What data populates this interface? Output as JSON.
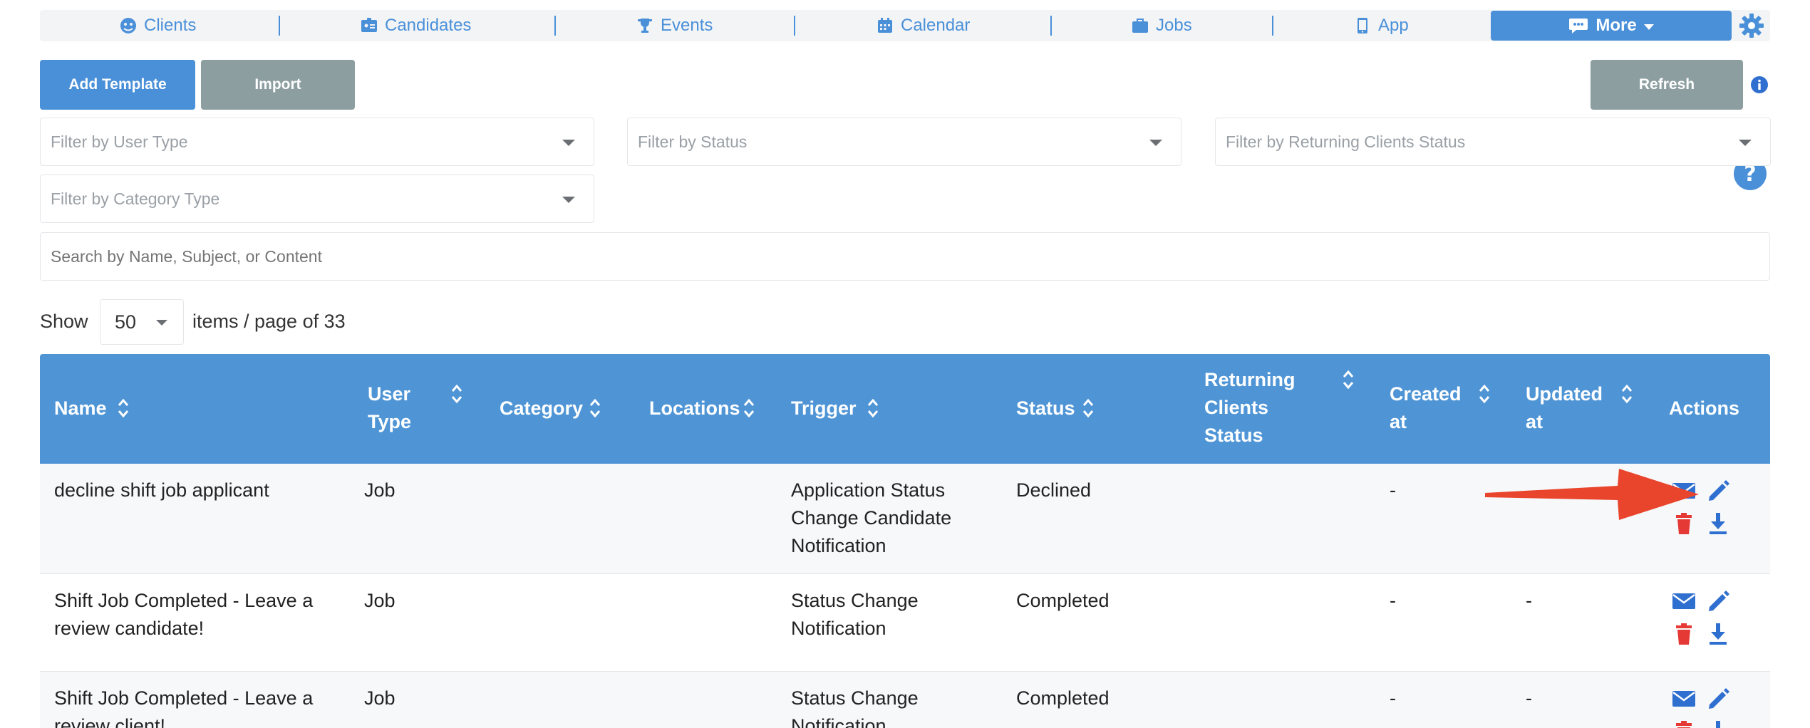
{
  "nav": {
    "items": [
      {
        "label": "Clients",
        "icon": "clients-icon"
      },
      {
        "label": "Candidates",
        "icon": "candidates-icon"
      },
      {
        "label": "Events",
        "icon": "trophy-icon"
      },
      {
        "label": "Calendar",
        "icon": "calendar-icon"
      },
      {
        "label": "Jobs",
        "icon": "briefcase-icon"
      },
      {
        "label": "App",
        "icon": "phone-icon"
      }
    ],
    "more_label": "More",
    "settings_icon": "gear-icon"
  },
  "toolbar": {
    "add_template_label": "Add Template",
    "import_label": "Import",
    "refresh_label": "Refresh"
  },
  "filters": {
    "user_type_placeholder": "Filter by User Type",
    "status_placeholder": "Filter by Status",
    "returning_placeholder": "Filter by Returning Clients Status",
    "category_placeholder": "Filter by Category Type",
    "search_placeholder": "Search by Name, Subject, or Content"
  },
  "pagination": {
    "show_label": "Show",
    "per_page": "50",
    "items_label": "items / page of 33"
  },
  "table": {
    "headers": {
      "name": "Name",
      "user_type_1": "User",
      "user_type_2": "Type",
      "category": "Category",
      "locations": "Locations",
      "trigger": "Trigger",
      "status": "Status",
      "returning_1": "Returning",
      "returning_2": "Clients",
      "returning_3": "Status",
      "created_1": "Created",
      "created_2": "at",
      "updated_1": "Updated",
      "updated_2": "at",
      "actions": "Actions"
    },
    "rows": [
      {
        "name_1": "decline shift job applicant",
        "name_2": "",
        "user_type": "Job",
        "trigger_1": "Application Status",
        "trigger_2": "Change Candidate",
        "trigger_3": "Notification",
        "status": "Declined",
        "created": "-",
        "updated": ""
      },
      {
        "name_1": "Shift Job Completed - Leave a",
        "name_2": "review candidate!",
        "user_type": "Job",
        "trigger_1": "Status Change",
        "trigger_2": "Notification",
        "trigger_3": "",
        "status": "Completed",
        "created": "-",
        "updated": "-"
      },
      {
        "name_1": "Shift Job Completed - Leave a",
        "name_2": "review client!",
        "user_type": "Job",
        "trigger_1": "Status Change",
        "trigger_2": "Notification",
        "trigger_3": "",
        "status": "Completed",
        "created": "-",
        "updated": "-"
      }
    ]
  },
  "colors": {
    "primary": "#4a90d9",
    "header_bg": "#4f95d6",
    "secondary_button": "#8d9ea1",
    "danger": "#e53935",
    "annotation_arrow": "#e8452c"
  }
}
